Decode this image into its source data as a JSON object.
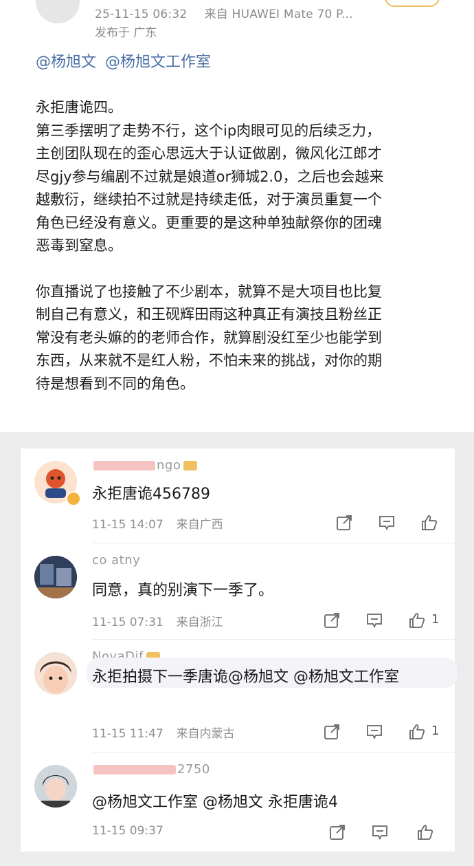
{
  "post": {
    "timestamp": "25-11-15 06:32",
    "source": "来自 HUAWEI Mate 70 P...",
    "location": "发布于 广东",
    "mentions": [
      "@杨旭文",
      "@杨旭文工作室"
    ],
    "paragraphs": [
      [
        "永拒唐诡四。",
        "第三季摆明了走势不行，这个ip肉眼可见的后续乏力，",
        "主创团队现在的歪心思远大于认证做剧，微风化江郎才",
        "尽gjy参与编剧不过就是娘道or狮城2.0，之后也会越来",
        "越敷衍，继续拍不过就是持续走低，对于演员重复一个",
        "角色已经没有意义。更重要的是这种单独献祭你的团魂",
        "恶毒到窒息。"
      ],
      [
        "你直播说了也接触了不少剧本，就算不是大项目也比复",
        "制自己有意义，和王砚辉田雨这种真正有演技且粉丝正",
        "常没有老头嫲的的老师合作，就算剧没红至少也能学到",
        "东西，从来就不是红人粉，不怕未来的挑战，对你的期",
        "待是想看到不同的角色。"
      ]
    ]
  },
  "comments": [
    {
      "name": "ngo",
      "text": "永拒唐诡456789",
      "time": "11-15 14:07",
      "region": "来自广西",
      "likes": ""
    },
    {
      "name": "co        atny",
      "text": "同意，真的别演下一季了。",
      "time": "11-15 07:31",
      "region": "来自浙江",
      "likes": "1"
    },
    {
      "name": "NovaDif",
      "text": "永拒拍摄下一季唐诡@杨旭文 @杨旭文工作室",
      "time": "11-15 11:47",
      "region": "来自内蒙古",
      "likes": "1"
    },
    {
      "name": "2750",
      "text": "@杨旭文工作室 @杨旭文 永拒唐诡4",
      "time": "11-15 09:37",
      "region": "",
      "likes": ""
    }
  ],
  "colors": {
    "mention": "#4a6fa5",
    "meta": "#8f8f8f",
    "icon": "#666666"
  },
  "icons": [
    "share-icon",
    "comment-icon",
    "like-icon"
  ]
}
